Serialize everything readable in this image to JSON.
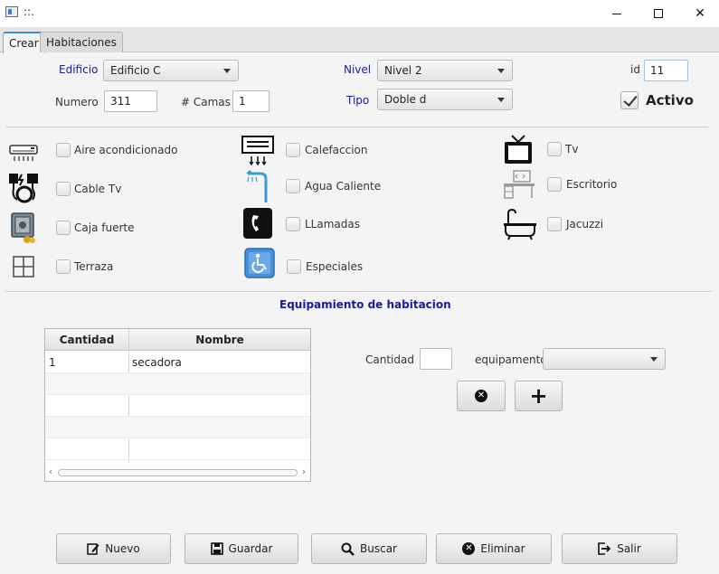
{
  "window": {
    "title": "::.",
    "minimize_icon": "minimize-icon",
    "maximize_icon": "maximize-icon",
    "close_glyph": "✕"
  },
  "tabs": [
    {
      "label": "Crear",
      "active": true
    },
    {
      "label": "Habitaciones",
      "active": false
    }
  ],
  "form": {
    "edificio": {
      "label": "Edificio",
      "value": "Edificio C"
    },
    "nivel": {
      "label": "Nivel",
      "value": "Nivel 2"
    },
    "id": {
      "label": "id",
      "value": "11"
    },
    "numero": {
      "label": "Numero",
      "value": "311"
    },
    "camas": {
      "label": "# Camas",
      "value": "1"
    },
    "tipo": {
      "label": "Tipo",
      "value": "Doble d"
    },
    "activo": {
      "label": "Activo",
      "checked": true
    }
  },
  "amenities": [
    {
      "label": "Aire acondicionado",
      "icon": "air-conditioner-icon",
      "checked": false
    },
    {
      "label": "Calefaccion",
      "icon": "heater-icon",
      "checked": false
    },
    {
      "label": "Tv",
      "icon": "tv-icon",
      "checked": false
    },
    {
      "label": "Cable Tv",
      "icon": "cable-tv-icon",
      "checked": false
    },
    {
      "label": "Agua Caliente",
      "icon": "shower-icon",
      "checked": false
    },
    {
      "label": "Escritorio",
      "icon": "desk-icon",
      "checked": false
    },
    {
      "label": "Caja fuerte",
      "icon": "safe-icon",
      "checked": false
    },
    {
      "label": "LLamadas",
      "icon": "phone-icon",
      "checked": false
    },
    {
      "label": "Jacuzzi",
      "icon": "bathtub-icon",
      "checked": false
    },
    {
      "label": "Terraza",
      "icon": "window-icon",
      "checked": false
    },
    {
      "label": "Especiales",
      "icon": "accessibility-icon",
      "checked": false
    }
  ],
  "equipment": {
    "title": "Equipamiento de habitacion",
    "columns": [
      "Cantidad",
      "Nombre"
    ],
    "rows": [
      {
        "cantidad": "1",
        "nombre": "secadora"
      }
    ],
    "cantidad_label": "Cantidad",
    "cantidad_value": "",
    "equipamento_label": "equipamento",
    "equipamento_value": ""
  },
  "actions": [
    {
      "label": "Nuevo",
      "icon": "edit-icon"
    },
    {
      "label": "Guardar",
      "icon": "save-icon"
    },
    {
      "label": "Buscar",
      "icon": "search-icon"
    },
    {
      "label": "Eliminar",
      "icon": "delete-icon"
    },
    {
      "label": "Salir",
      "icon": "exit-icon"
    }
  ],
  "colors": {
    "label_blue": "#1a1a9e",
    "tab_accent": "#3b8fd8"
  }
}
